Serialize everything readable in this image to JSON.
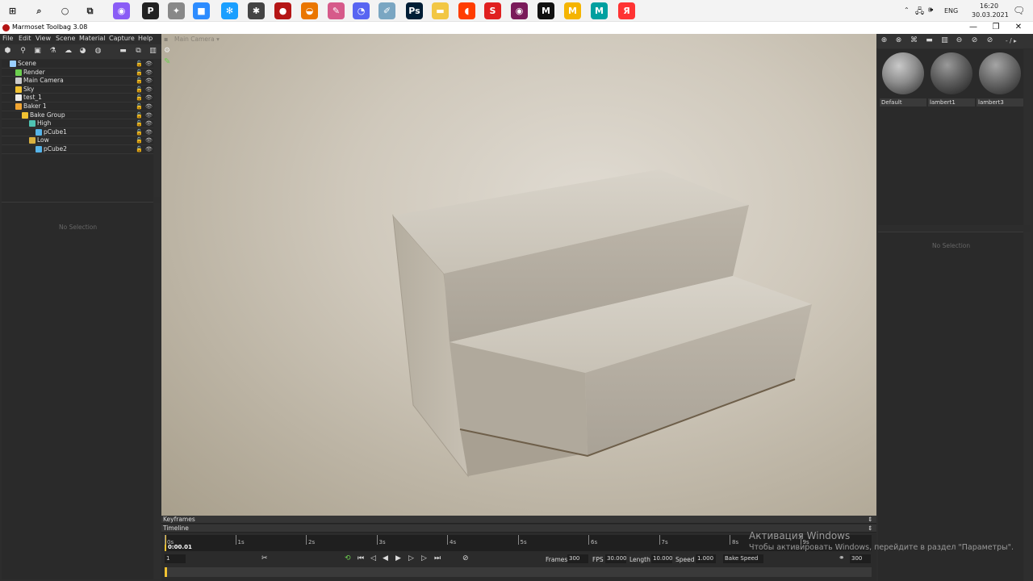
{
  "window": {
    "title": "Marmoset Toolbag 3.08",
    "minimize": "—",
    "maximize": "❐",
    "close": "✕"
  },
  "taskbar": {
    "tray": {
      "language": "ENG",
      "time": "16:20",
      "date": "30.03.2021"
    },
    "apps": [
      {
        "name": "windows-start-icon",
        "color": "#1f1f1f"
      },
      {
        "name": "search-icon",
        "color": "#1f1f1f"
      },
      {
        "name": "cortana-icon",
        "color": "#1f1f1f"
      },
      {
        "name": "task-view-icon",
        "color": "#1f1f1f"
      },
      {
        "name": "alice-icon",
        "color": "#8a5cf6"
      },
      {
        "name": "pinterest-icon",
        "color": "#222222"
      },
      {
        "name": "app-icon",
        "color": "#888888"
      },
      {
        "name": "zoom-icon",
        "color": "#2d8cff"
      },
      {
        "name": "app-icon",
        "color": "#1a9fff"
      },
      {
        "name": "zbrush-icon",
        "color": "#444444"
      },
      {
        "name": "marmoset-icon",
        "color": "#b51515"
      },
      {
        "name": "blender-icon",
        "color": "#ea7600"
      },
      {
        "name": "app-icon",
        "color": "#d65a8a"
      },
      {
        "name": "discord-icon",
        "color": "#5865f2"
      },
      {
        "name": "app-icon",
        "color": "#7aa6c2"
      },
      {
        "name": "photoshop-icon",
        "color": "#001e36"
      },
      {
        "name": "file-explorer-icon",
        "color": "#f2c744"
      },
      {
        "name": "app-icon",
        "color": "#ff3d00"
      },
      {
        "name": "app-icon",
        "color": "#e02020"
      },
      {
        "name": "app-icon",
        "color": "#7a1a5a"
      },
      {
        "name": "app-icon",
        "color": "#111111"
      },
      {
        "name": "app-icon",
        "color": "#f5b400"
      },
      {
        "name": "app-icon",
        "color": "#00a0a0"
      },
      {
        "name": "yandex-browser-icon",
        "color": "#ff3333"
      }
    ],
    "app_glyphs": [
      "⊞",
      "⌕",
      "○",
      "⧉",
      "◉",
      "P",
      "✦",
      "■",
      "✻",
      "✱",
      "●",
      "◒",
      "✎",
      "◔",
      "✐",
      "Ps",
      "▬",
      "◖",
      "S",
      "◉",
      "M",
      "M",
      "M",
      "Я"
    ]
  },
  "menu": [
    "File",
    "Edit",
    "View",
    "Scene",
    "Material",
    "Capture",
    "Help"
  ],
  "outliner": {
    "items": [
      {
        "label": "Scene",
        "indent": 0,
        "icon_color": "#9ad0ff"
      },
      {
        "label": "Render",
        "indent": 1,
        "icon_color": "#6ccf4f"
      },
      {
        "label": "Main Camera",
        "indent": 1,
        "icon_color": "#cccccc"
      },
      {
        "label": "Sky",
        "indent": 1,
        "icon_color": "#f1c232"
      },
      {
        "label": "test_1",
        "indent": 1,
        "icon_color": "#eeeeee"
      },
      {
        "label": "Baker 1",
        "indent": 1,
        "icon_color": "#f1a532"
      },
      {
        "label": "Bake Group",
        "indent": 2,
        "icon_color": "#f1c232"
      },
      {
        "label": "High",
        "indent": 3,
        "icon_color": "#4fc3b3"
      },
      {
        "label": "pCube1",
        "indent": 4,
        "icon_color": "#56b4e9"
      },
      {
        "label": "Low",
        "indent": 3,
        "icon_color": "#d8b040"
      },
      {
        "label": "pCube2",
        "indent": 4,
        "icon_color": "#56b4e9"
      }
    ]
  },
  "left_props": {
    "no_selection": "No Selection"
  },
  "viewport": {
    "camera_label": "Main Camera ▾"
  },
  "timeline": {
    "keyframes_label": "Keyframes",
    "timeline_label": "Timeline",
    "current_time": "0:00.01",
    "ticks": [
      "0s",
      "1s",
      "2s",
      "3s",
      "4s",
      "5s",
      "6s",
      "7s",
      "8s",
      "9s"
    ],
    "frame_field": "1",
    "frames_label": "Frames",
    "frames_value": "300",
    "fps_label": "FPS",
    "fps_value": "30.000",
    "length_label": "Length",
    "length_value": "10.000",
    "speed_label": "Speed",
    "speed_value": "1.000",
    "bake_speed": "Bake Speed",
    "end_frame": "300"
  },
  "materials": {
    "items": [
      {
        "label": "Default"
      },
      {
        "label": "lambert1"
      },
      {
        "label": "lambert3"
      }
    ],
    "counter": "- / ▸",
    "no_selection": "No Selection"
  },
  "watermark": {
    "line1": "Активация Windows",
    "line2": "Чтобы активировать Windows, перейдите в раздел \"Параметры\"."
  }
}
